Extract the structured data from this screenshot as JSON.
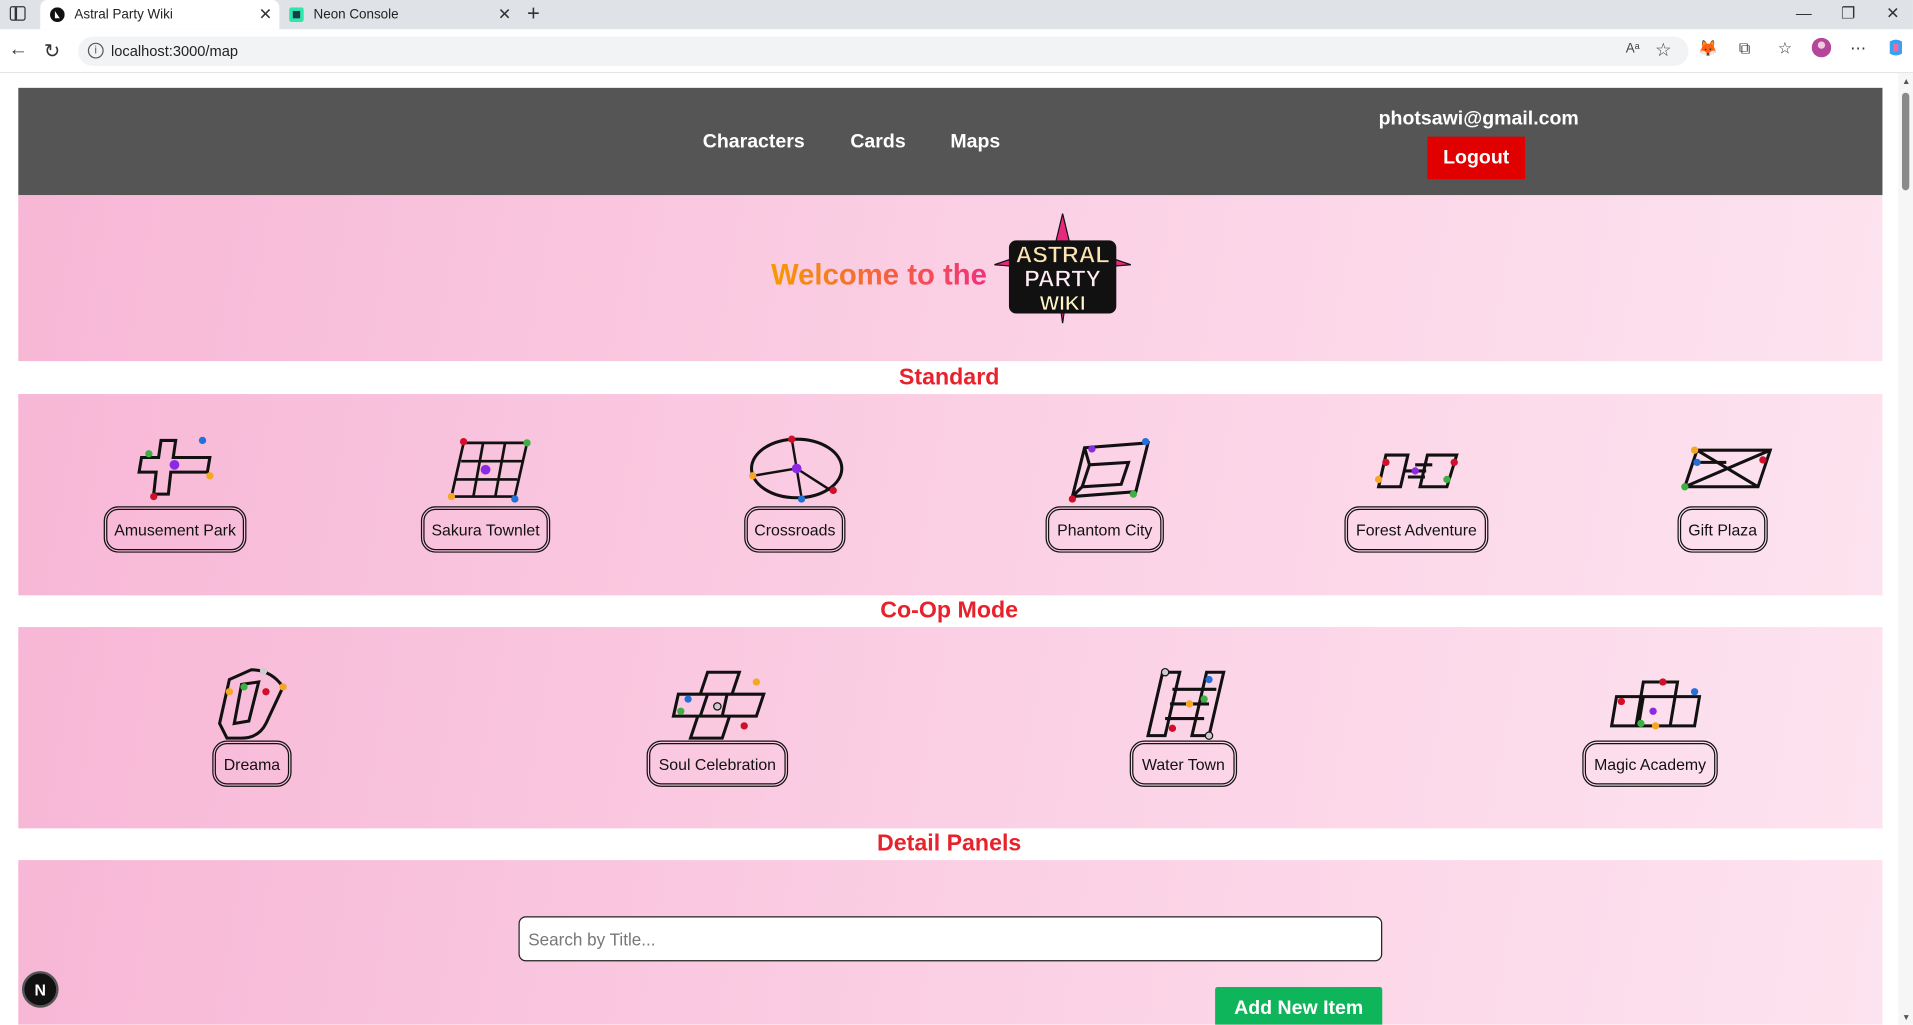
{
  "browser": {
    "tabs": [
      {
        "title": "Astral Party Wiki",
        "active": true
      },
      {
        "title": "Neon Console",
        "active": false
      }
    ],
    "url": "localhost:3000/map"
  },
  "header": {
    "nav": [
      "Characters",
      "Cards",
      "Maps"
    ],
    "email": "photsawi@gmail.com",
    "logout_label": "Logout"
  },
  "banner": {
    "welcome": "Welcome to the",
    "logo_text": [
      "ASTRAL",
      "PARTY",
      "WIKI"
    ]
  },
  "sections": {
    "standard": {
      "title": "Standard",
      "maps": [
        "Amusement Park",
        "Sakura Townlet",
        "Crossroads",
        "Phantom City",
        "Forest Adventure",
        "Gift Plaza"
      ]
    },
    "coop": {
      "title": "Co-Op Mode",
      "maps": [
        "Dreama",
        "Soul Celebration",
        "Water Town",
        "Magic Academy"
      ]
    },
    "detail": {
      "title": "Detail Panels",
      "search_placeholder": "Search by Title...",
      "add_label": "Add New Item"
    }
  },
  "dev_badge": "N",
  "colors": {
    "header_bg": "#555555",
    "logout": "#e00000",
    "section_title": "#e8222c",
    "add_button": "#0fb55a"
  }
}
